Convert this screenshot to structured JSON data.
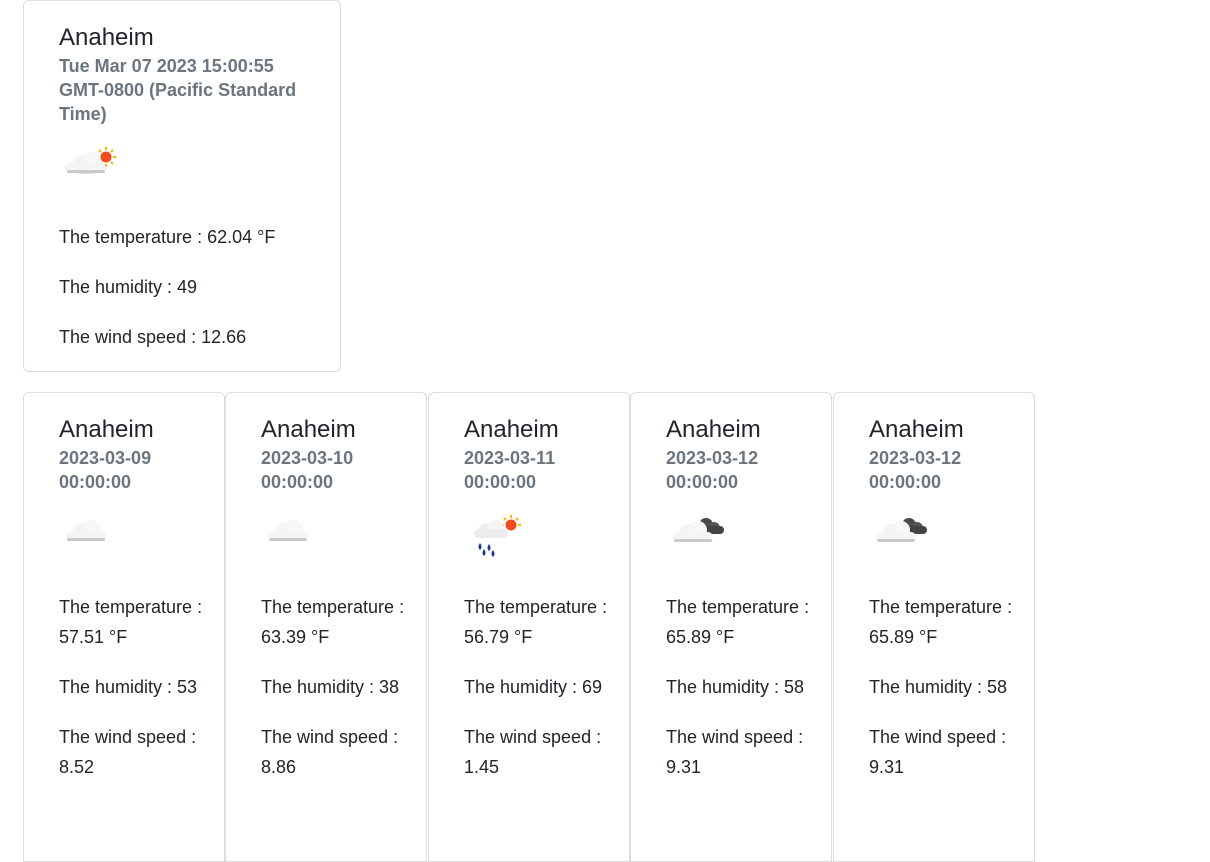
{
  "current": {
    "city": "Anaheim",
    "datetime": "Tue Mar 07 2023 15:00:55 GMT-0800 (Pacific Standard Time)",
    "icon": "partly-cloudy-day-icon",
    "temperature": "The temperature : 62.04 °F",
    "humidity": "The humidity : 49",
    "wind": "The wind speed : 12.66"
  },
  "forecast": [
    {
      "city": "Anaheim",
      "date": "2023-03-09 00:00:00",
      "icon": "cloud-icon",
      "temperature": "The temperature : 57.51 °F",
      "humidity": "The humidity : 53",
      "wind": "The wind speed : 8.52"
    },
    {
      "city": "Anaheim",
      "date": "2023-03-10 00:00:00",
      "icon": "cloud-icon",
      "temperature": "The temperature : 63.39 °F",
      "humidity": "The humidity : 38",
      "wind": "The wind speed : 8.86"
    },
    {
      "city": "Anaheim",
      "date": "2023-03-11 00:00:00",
      "icon": "rain-sun-icon",
      "temperature": "The temperature : 56.79 °F",
      "humidity": "The humidity : 69",
      "wind": "The wind speed : 1.45"
    },
    {
      "city": "Anaheim",
      "date": "2023-03-12 00:00:00",
      "icon": "broken-clouds-icon",
      "temperature": "The temperature : 65.89 °F",
      "humidity": "The humidity : 58",
      "wind": "The wind speed : 9.31"
    },
    {
      "city": "Anaheim",
      "date": "2023-03-12 00:00:00",
      "icon": "broken-clouds-icon",
      "temperature": "The temperature : 65.89 °F",
      "humidity": "The humidity : 58",
      "wind": "The wind speed : 9.31"
    }
  ]
}
